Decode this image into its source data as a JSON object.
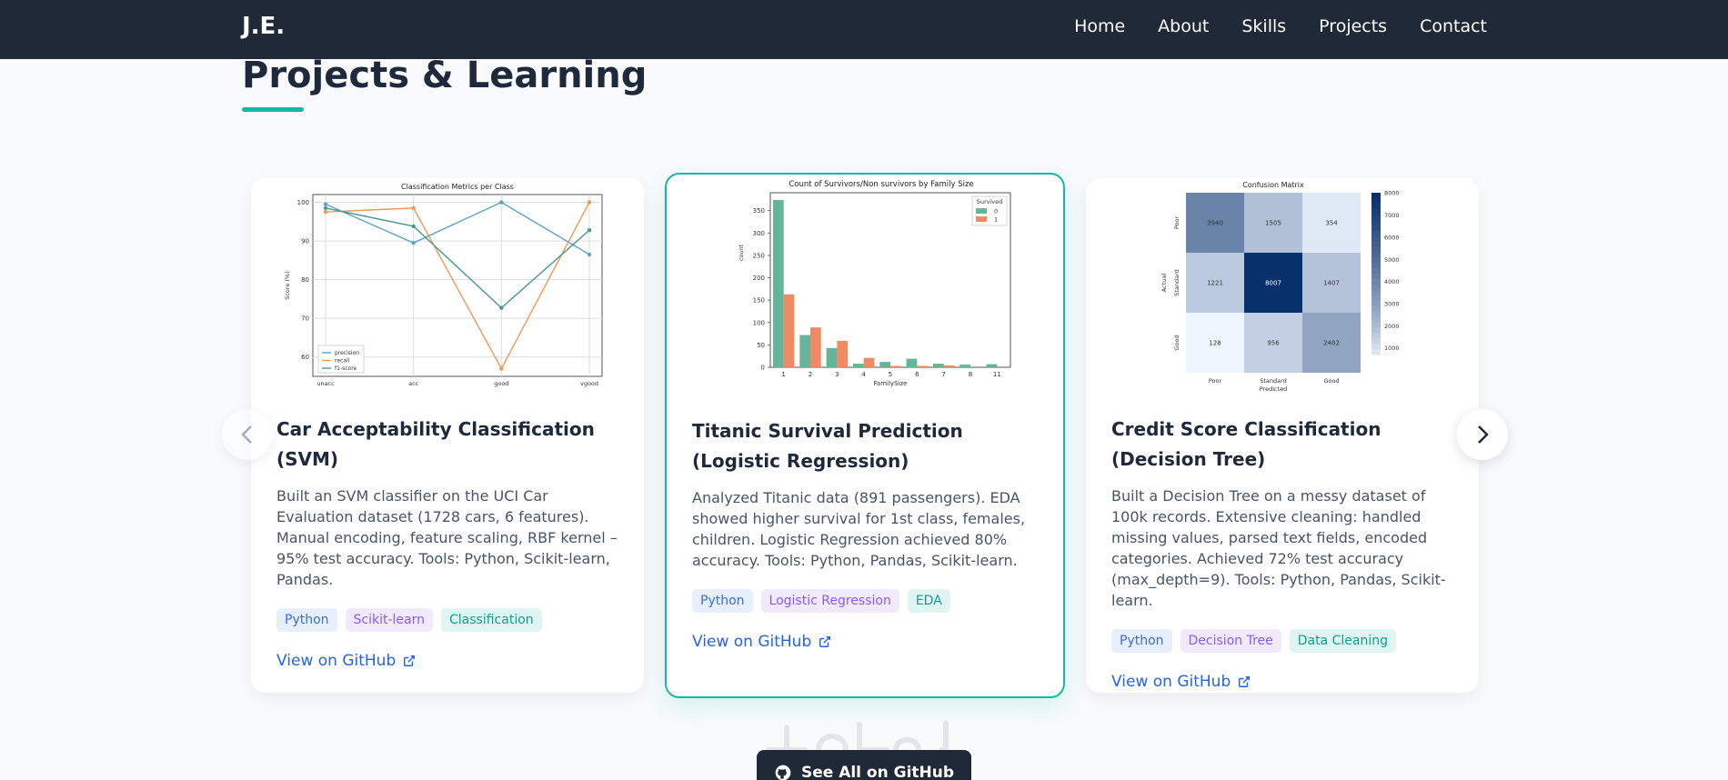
{
  "nav": {
    "logo": "J.E.",
    "links": [
      "Home",
      "About",
      "Skills",
      "Projects",
      "Contact"
    ]
  },
  "section": {
    "title": "Projects & Learning"
  },
  "cards": [
    {
      "title": "Car Acceptability Classification (SVM)",
      "description": "Built an SVM classifier on the UCI Car Evaluation dataset (1728 cars, 6 features). Manual encoding, feature scaling, RBF kernel – 95% test accuracy. Tools: Python, Scikit-learn, Pandas.",
      "tags": [
        {
          "label": "Python",
          "color": "blue"
        },
        {
          "label": "Scikit-learn",
          "color": "purple"
        },
        {
          "label": "Classification",
          "color": "teal"
        }
      ],
      "link": "View on GitHub"
    },
    {
      "title": "Titanic Survival Prediction (Logistic Regression)",
      "description": "Analyzed Titanic data (891 passengers). EDA showed higher survival for 1st class, females, children. Logistic Regression achieved 80% accuracy. Tools: Python, Pandas, Scikit-learn.",
      "tags": [
        {
          "label": "Python",
          "color": "blue"
        },
        {
          "label": "Logistic Regression",
          "color": "purple"
        },
        {
          "label": "EDA",
          "color": "teal"
        }
      ],
      "link": "View on GitHub"
    },
    {
      "title": "Credit Score Classification (Decision Tree)",
      "description": "Built a Decision Tree on a messy dataset of 100k records. Extensive cleaning: handled missing values, parsed text fields, encoded categories. Achieved 72% test accuracy (max_depth=9). Tools: Python, Pandas, Scikit-learn.",
      "tags": [
        {
          "label": "Python",
          "color": "blue"
        },
        {
          "label": "Decision Tree",
          "color": "purple"
        },
        {
          "label": "Data Cleaning",
          "color": "teal"
        }
      ],
      "link": "View on GitHub"
    }
  ],
  "see_all_label": "See All on GitHub",
  "chart_data": [
    {
      "type": "line",
      "title": "Classification Metrics per Class",
      "xlabel": "",
      "ylabel": "Score (%)",
      "categories": [
        "unacc",
        "acc",
        "good",
        "vgood"
      ],
      "ylim": [
        55,
        102
      ],
      "yticks": [
        60,
        70,
        80,
        90,
        100
      ],
      "grid": true,
      "legend": "bottom-left",
      "series": [
        {
          "name": "precision",
          "values": [
            99.5,
            89.5,
            100,
            86.5
          ],
          "color": "#5ba3c8"
        },
        {
          "name": "recall",
          "values": [
            97.5,
            98.5,
            57,
            100
          ],
          "color": "#f19855"
        },
        {
          "name": "f1-score",
          "values": [
            98.5,
            93.8,
            72.7,
            92.8
          ],
          "color": "#4a9a86"
        }
      ]
    },
    {
      "type": "bar",
      "title": "Count of Survivors/Non survivors by Family Size",
      "xlabel": "FamilySize",
      "ylabel": "count",
      "categories": [
        "1",
        "2",
        "3",
        "4",
        "5",
        "6",
        "7",
        "8",
        "11"
      ],
      "ylim": [
        0,
        390
      ],
      "yticks": [
        0,
        50,
        100,
        150,
        200,
        250,
        300,
        350
      ],
      "legend": "top-right",
      "legend_title": "Survived",
      "series": [
        {
          "name": "0",
          "values": [
            374,
            72,
            43,
            8,
            12,
            19,
            8,
            6,
            7
          ],
          "color": "#66b59b"
        },
        {
          "name": "1",
          "values": [
            163,
            89,
            59,
            21,
            3,
            3,
            4,
            0,
            0
          ],
          "color": "#ee8b62"
        }
      ]
    },
    {
      "type": "heatmap",
      "title": "Confusion Matrix",
      "xlabel": "Predicted",
      "ylabel": "Actual",
      "x_labels": [
        "Poor",
        "Standard",
        "Good"
      ],
      "y_labels": [
        "Poor",
        "Standard",
        "Good"
      ],
      "values": [
        [
          3940,
          1505,
          354
        ],
        [
          1221,
          8007,
          1407
        ],
        [
          128,
          956,
          2482
        ]
      ],
      "colorbar_ticks": [
        1000,
        2000,
        3000,
        4000,
        5000,
        6000,
        7000,
        8000
      ]
    }
  ]
}
